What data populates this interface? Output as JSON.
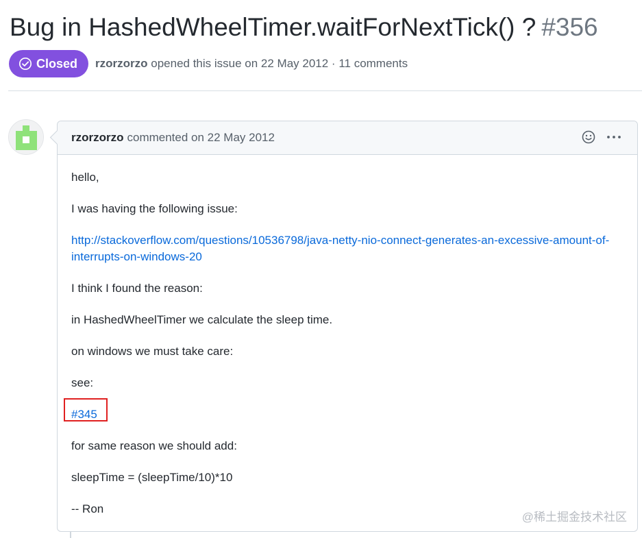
{
  "issue": {
    "title": "Bug in HashedWheelTimer.waitForNextTick() ?",
    "number": "#356",
    "state": "Closed",
    "author": "rzorzorzo",
    "meta": "opened this issue on 22 May 2012 · 11 comments"
  },
  "comment": {
    "author": "rzorzorzo",
    "meta": "commented on 22 May 2012",
    "emoji_icon": "smiley-icon",
    "more_icon": "kebab-horizontal-icon",
    "body": {
      "greeting": "hello,",
      "line_issue": "I was having the following issue:",
      "link_text": "http://stackoverflow.com/questions/10536798/java-netty-nio-connect-generates-an-excessive-amount-of-interrupts-on-windows-20",
      "line_reason": "I think I found the reason:",
      "line_timer": "in HashedWheelTimer we calculate the sleep time.",
      "line_windows": "on windows we must take care:",
      "line_see": "see:",
      "issue_ref": "#345",
      "line_same": "for same reason we should add:",
      "code_line": "sleepTime = (sleepTime/10)*10",
      "signature": "-- Ron"
    }
  },
  "watermark": "@稀土掘金技术社区",
  "colors": {
    "closed_badge": "#8250df",
    "link": "#0969da",
    "highlight": "#e02020",
    "avatar_green": "#8fe27a"
  }
}
